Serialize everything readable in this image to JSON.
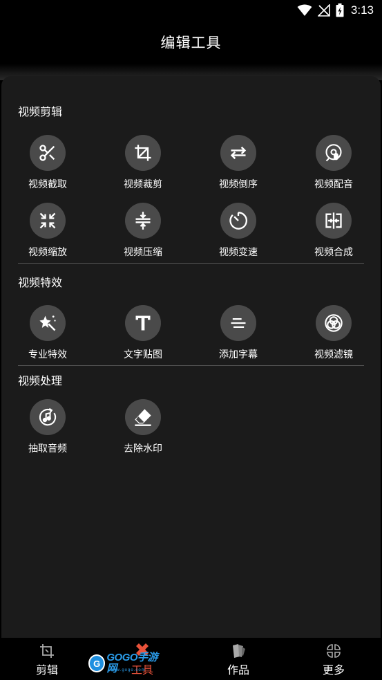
{
  "status_bar": {
    "time": "3:13"
  },
  "header": {
    "title": "编辑工具"
  },
  "sections": [
    {
      "title": "视频剪辑",
      "tools": [
        {
          "label": "视频截取",
          "icon": "scissors-icon"
        },
        {
          "label": "视频裁剪",
          "icon": "crop-icon"
        },
        {
          "label": "视频倒序",
          "icon": "swap-arrows-icon"
        },
        {
          "label": "视频配音",
          "icon": "voiceover-icon"
        },
        {
          "label": "视频缩放",
          "icon": "shrink-arrows-icon"
        },
        {
          "label": "视频压缩",
          "icon": "compress-icon"
        },
        {
          "label": "视频变速",
          "icon": "timer-icon"
        },
        {
          "label": "视频合成",
          "icon": "merge-icon"
        }
      ]
    },
    {
      "title": "视频特效",
      "tools": [
        {
          "label": "专业特效",
          "icon": "magic-wand-icon"
        },
        {
          "label": "文字贴图",
          "icon": "text-icon"
        },
        {
          "label": "添加字幕",
          "icon": "subtitles-icon"
        },
        {
          "label": "视频滤镜",
          "icon": "filter-circles-icon"
        }
      ]
    },
    {
      "title": "视频处理",
      "tools": [
        {
          "label": "抽取音频",
          "icon": "music-note-icon"
        },
        {
          "label": "去除水印",
          "icon": "eraser-icon"
        }
      ]
    }
  ],
  "bottom_nav": [
    {
      "label": "剪辑",
      "icon": "crop-icon",
      "active": false
    },
    {
      "label": "工具",
      "icon": "tools-icon",
      "active": true
    },
    {
      "label": "作品",
      "icon": "works-icon",
      "active": false
    },
    {
      "label": "更多",
      "icon": "grid-icon",
      "active": false
    }
  ],
  "watermark": {
    "text": "GOGO手游网",
    "subtext": "www.gogo.com",
    "logo_letter": "G"
  },
  "colors": {
    "background": "#000000",
    "panel": "#1b1b1b",
    "icon_circle": "#4a4a4a",
    "active": "#e8523a"
  }
}
